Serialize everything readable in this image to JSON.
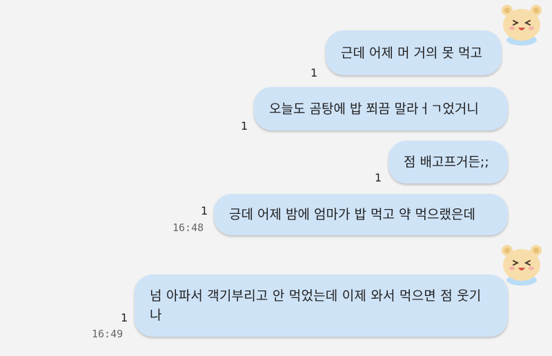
{
  "messages": [
    {
      "text": "근데 어제 머 거의 못 먹고",
      "read_count": "1",
      "time": ""
    },
    {
      "text": "오늘도 곰탕에 밥 쬐끔 말라ㅓㄱ었거니",
      "read_count": "1",
      "time": ""
    },
    {
      "text": "점 배고프거든;;",
      "read_count": "1",
      "time": ""
    },
    {
      "text": "긍데 어제 밤에 엄마가 밥 먹고 약 먹으랬은데",
      "read_count": "1",
      "time": "16:48"
    },
    {
      "text": "넘 아파서 객기부리고 안 먹었는데 이제 와서 먹으면 점 웃기나",
      "read_count": "1",
      "time": "16:49"
    }
  ],
  "colors": {
    "bubble": "#cfe3f7",
    "background": "#f3f3f3"
  },
  "icons": {
    "avatar": "bear-avatar-icon"
  }
}
